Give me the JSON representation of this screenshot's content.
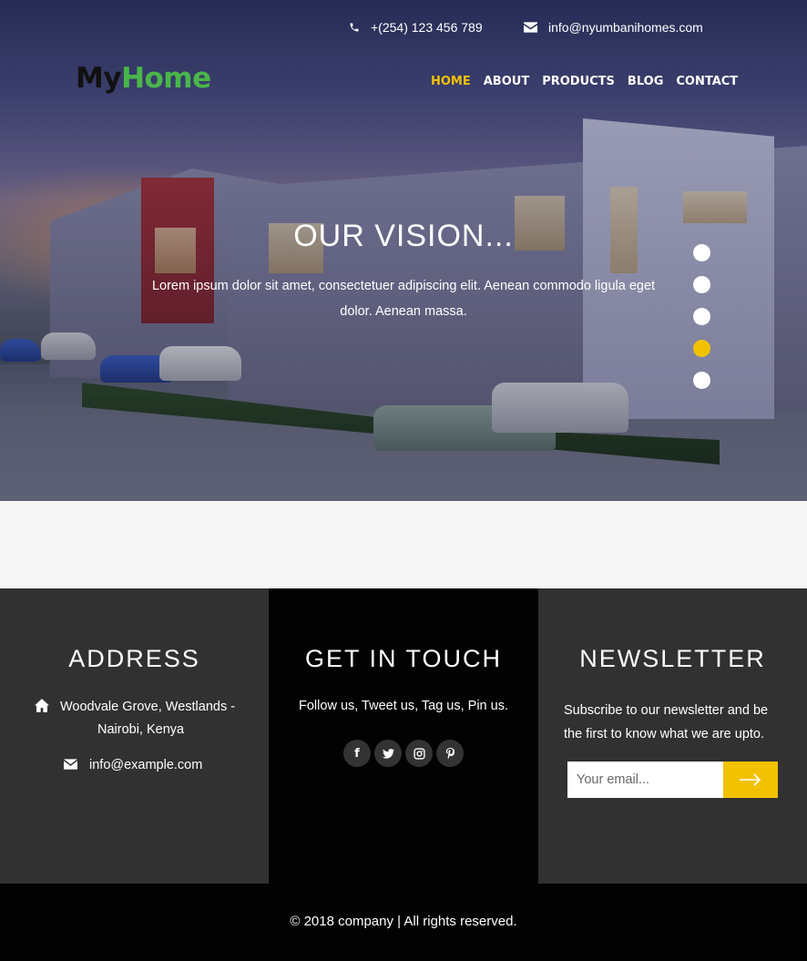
{
  "header": {
    "phone": "+(254) 123 456 789",
    "email": "info@nyumbanihomes.com",
    "logo_part1": "My",
    "logo_part2": "Home",
    "nav": [
      {
        "label": "HOME",
        "active": true
      },
      {
        "label": "ABOUT",
        "active": false
      },
      {
        "label": "PRODUCTS",
        "active": false
      },
      {
        "label": "BLOG",
        "active": false
      },
      {
        "label": "CONTACT",
        "active": false
      }
    ]
  },
  "slider": {
    "title": "OUR VISION...",
    "text": "Lorem ipsum dolor sit amet, consectetuer adipiscing elit. Aenean commodo ligula eget dolor. Aenean massa.",
    "dots": 5,
    "active_dot": 4
  },
  "address": {
    "title": "ADDRESS",
    "line1": "Woodvale Grove, Westlands -",
    "line2": "Nairobi, Kenya",
    "email": "info@example.com"
  },
  "touch": {
    "title": "GET IN TOUCH",
    "text": "Follow us, Tweet us, Tag us, Pin us.",
    "socials": [
      "facebook-icon",
      "twitter-icon",
      "instagram-icon",
      "pinterest-icon"
    ]
  },
  "newsletter": {
    "title": "NEWSLETTER",
    "text": "Subscribe to our newsletter and be the first to know what we are upto.",
    "placeholder": "Your email..."
  },
  "footer": {
    "copyright": "© 2018 company | All rights reserved."
  },
  "colors": {
    "accent": "#f2c200",
    "logo_green": "#49b64a",
    "dark_gray": "#313131",
    "black": "#020202"
  }
}
